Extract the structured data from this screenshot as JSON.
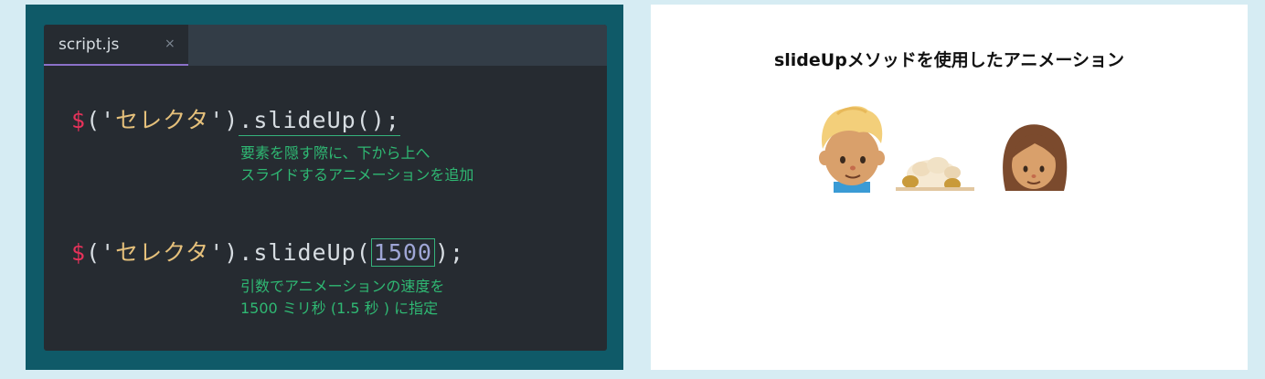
{
  "editor": {
    "tab": {
      "filename": "script.js",
      "close_glyph": "×"
    },
    "line1": {
      "dollar": "$",
      "open": "('",
      "selector": "セレクタ",
      "close": "')",
      "method": ".slideUp();"
    },
    "note1": {
      "line1": "要素を隠す際に、下から上へ",
      "line2": "スライドするアニメーションを追加"
    },
    "line2": {
      "dollar": "$",
      "open": "('",
      "selector": "セレクタ",
      "close": "')",
      "method": ".slideUp(",
      "argument": "1500",
      "end": ");"
    },
    "note2": {
      "line1": "引数でアニメーションの速度を",
      "line2": "1500 ミリ秒 (1.5 秒 ) に指定"
    }
  },
  "demo": {
    "title": "slideUpメソッドを使用したアニメーション"
  }
}
